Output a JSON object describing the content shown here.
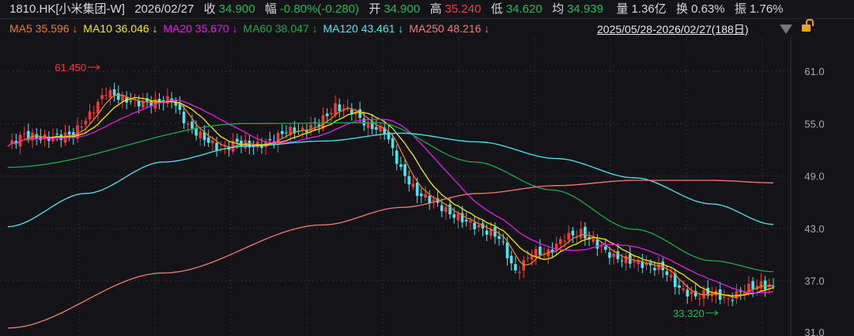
{
  "header": {
    "symbol": "1810.HK[小米集团-W]",
    "date": "2026/02/27",
    "close_label": "收",
    "close": "34.900",
    "change_label": "幅",
    "change": "-0.80%(-0.280)",
    "open_label": "开",
    "open": "34.900",
    "high_label": "高",
    "high": "35.240",
    "low_label": "低",
    "low": "34.620",
    "avg_label": "均",
    "avg": "34.939",
    "volume_label": "量",
    "volume": "1.36亿",
    "turnover_label": "换",
    "turnover": "0.63%",
    "amplitude_label": "振",
    "amplitude": "1.76%"
  },
  "ma_legend": [
    {
      "label": "MA5 35.596",
      "arrow": "↓",
      "color": "#f07c1c"
    },
    {
      "label": "MA10 36.046",
      "arrow": "↓",
      "color": "#f5e600"
    },
    {
      "label": "MA20 35.670",
      "arrow": "↓",
      "color": "#e01ee0"
    },
    {
      "label": "MA60 38.047",
      "arrow": "↓",
      "color": "#1aa84a"
    },
    {
      "label": "MA120 43.461",
      "arrow": "↓",
      "color": "#4fe3ee"
    },
    {
      "label": "MA250 48.216",
      "arrow": "↓",
      "color": "#f07a72"
    }
  ],
  "range": {
    "text": "2025/05/28-2026/02/27(188日)",
    "dropdown_icon": "triangle-down-icon",
    "lock_icon": "unlock-icon"
  },
  "colors": {
    "up": "#f03a3a",
    "down": "#4fe3ee",
    "background": "#141418",
    "grid": "#2c2c34"
  },
  "chart_data": {
    "type": "candlestick",
    "days": 188,
    "sample_step_days": 4,
    "ylim": [
      31.0,
      63.5
    ],
    "yticks": [
      "61.0",
      "55.0",
      "49.0",
      "43.0",
      "37.0"
    ],
    "closes": [
      52.4,
      53.8,
      53.3,
      53.5,
      53.8,
      56.0,
      58.7,
      57.8,
      57.4,
      57.4,
      57.8,
      54.7,
      53.3,
      52.0,
      52.9,
      52.4,
      52.9,
      54.2,
      54.2,
      55.1,
      56.9,
      56.5,
      54.7,
      54.2,
      49.7,
      47.0,
      46.1,
      44.7,
      43.8,
      42.9,
      42.0,
      37.9,
      40.2,
      40.2,
      42.0,
      42.5,
      41.1,
      39.7,
      39.3,
      38.8,
      38.4,
      36.1,
      35.2,
      35.7,
      34.8,
      36.1,
      36.6,
      36.1,
      34.9
    ],
    "series": [
      {
        "name": "MA60",
        "color": "#1aa84a",
        "points": [
          [
            0,
            50.0
          ],
          [
            58,
            55.0
          ],
          [
            90,
            55.1
          ],
          [
            114,
            50.6
          ],
          [
            133,
            47.4
          ],
          [
            153,
            42.9
          ],
          [
            172,
            39.3
          ],
          [
            187,
            38.047
          ]
        ]
      },
      {
        "name": "MA120",
        "color": "#4fe3ee",
        "points": [
          [
            0,
            43.2
          ],
          [
            19,
            47.0
          ],
          [
            38,
            50.6
          ],
          [
            58,
            52.4
          ],
          [
            77,
            53.0
          ],
          [
            96,
            53.9
          ],
          [
            115,
            52.9
          ],
          [
            134,
            51.0
          ],
          [
            153,
            48.8
          ],
          [
            172,
            45.8
          ],
          [
            187,
            43.461
          ]
        ]
      },
      {
        "name": "MA250",
        "color": "#f07a72",
        "points": [
          [
            0,
            31.6
          ],
          [
            38,
            37.9
          ],
          [
            77,
            43.4
          ],
          [
            96,
            45.4
          ],
          [
            115,
            47.0
          ],
          [
            134,
            47.9
          ],
          [
            153,
            48.5
          ],
          [
            172,
            48.5
          ],
          [
            187,
            48.216
          ]
        ]
      }
    ],
    "computed_ma": [
      {
        "name": "MA5",
        "period": 5,
        "color": "#f07c1c"
      },
      {
        "name": "MA10",
        "period": 10,
        "color": "#f5e600"
      },
      {
        "name": "MA20",
        "period": 20,
        "color": "#e01ee0"
      }
    ],
    "annotations": [
      {
        "text": "61.450",
        "day": 23,
        "value": 61.45,
        "color": "#f03a3a",
        "side": "left"
      },
      {
        "text": "33.320",
        "day": 174,
        "value": 33.32,
        "color": "#1db954",
        "side": "left"
      }
    ]
  }
}
